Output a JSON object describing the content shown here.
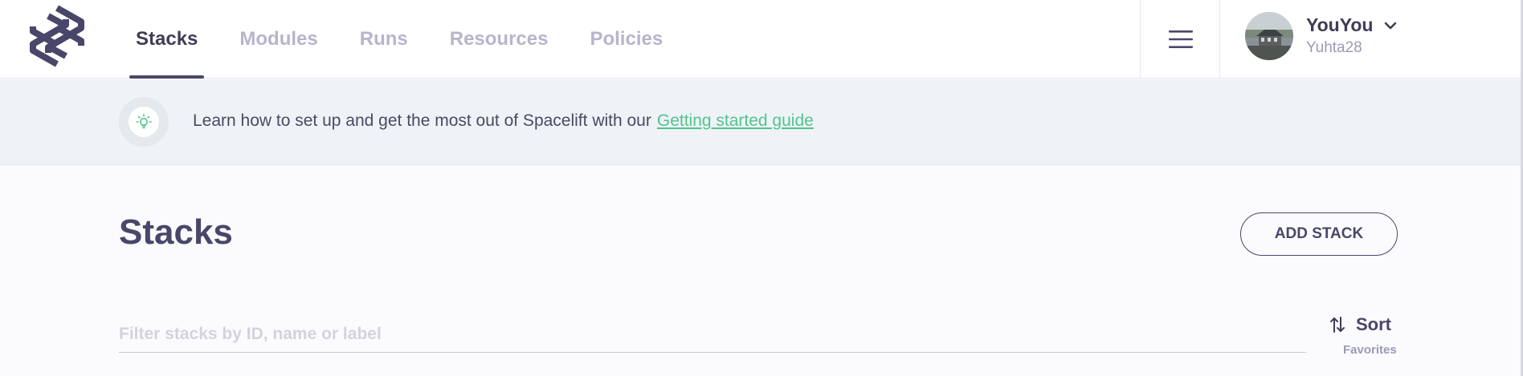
{
  "brand": {
    "name": "Spacelift"
  },
  "nav": {
    "tabs": [
      {
        "label": "Stacks",
        "active": true
      },
      {
        "label": "Modules",
        "active": false
      },
      {
        "label": "Runs",
        "active": false
      },
      {
        "label": "Resources",
        "active": false
      },
      {
        "label": "Policies",
        "active": false
      }
    ]
  },
  "menu": {
    "icon": "hamburger-menu-icon"
  },
  "user": {
    "name": "YouYou",
    "handle": "Yuhta28",
    "dropdown_icon": "chevron-down-icon"
  },
  "banner": {
    "icon": "lightbulb-icon",
    "text": "Learn how to set up and get the most out of Spacelift with our",
    "link_label": "Getting started guide"
  },
  "main": {
    "title": "Stacks",
    "add_button_label": "ADD STACK",
    "filter": {
      "placeholder": "Filter stacks by ID, name or label",
      "value": ""
    },
    "sort": {
      "label": "Sort",
      "value": "Favorites",
      "icon": "sort-arrows-icon"
    }
  },
  "colors": {
    "accent": "#48476a",
    "link": "#52c48b",
    "nav_inactive": "#b6b5cc",
    "banner_bg": "#eff3f7",
    "page_bg": "#fbfbfd"
  }
}
